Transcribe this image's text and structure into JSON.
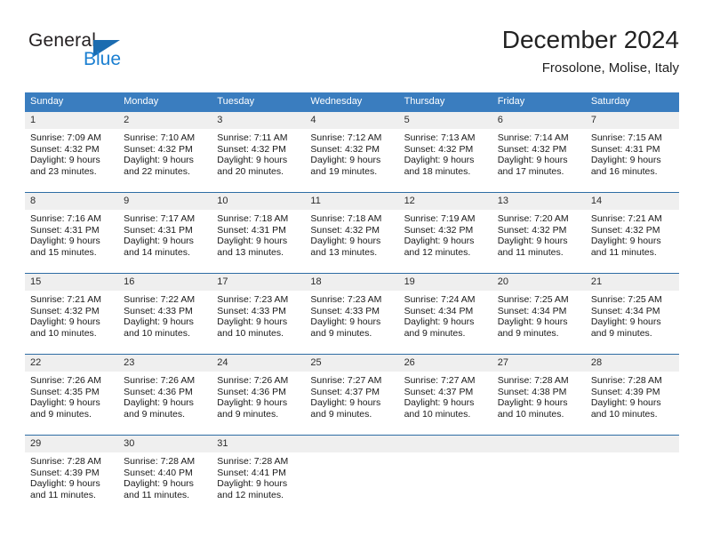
{
  "brand": {
    "name_top": "General",
    "name_bottom": "Blue",
    "triangle_icon": "brand-triangle-icon",
    "color_dark": "#231f20",
    "color_blue": "#1b7fd1"
  },
  "header": {
    "title": "December 2024",
    "subtitle": "Frosolone, Molise, Italy"
  },
  "theme": {
    "header_bg": "#3a7dbf",
    "daynum_bg": "#efefef",
    "row_rule": "#2e6da4"
  },
  "calendar": {
    "weekdays": [
      "Sunday",
      "Monday",
      "Tuesday",
      "Wednesday",
      "Thursday",
      "Friday",
      "Saturday"
    ],
    "weeks": [
      [
        {
          "day": "1",
          "sunrise": "Sunrise: 7:09 AM",
          "sunset": "Sunset: 4:32 PM",
          "daylight1": "Daylight: 9 hours",
          "daylight2": "and 23 minutes."
        },
        {
          "day": "2",
          "sunrise": "Sunrise: 7:10 AM",
          "sunset": "Sunset: 4:32 PM",
          "daylight1": "Daylight: 9 hours",
          "daylight2": "and 22 minutes."
        },
        {
          "day": "3",
          "sunrise": "Sunrise: 7:11 AM",
          "sunset": "Sunset: 4:32 PM",
          "daylight1": "Daylight: 9 hours",
          "daylight2": "and 20 minutes."
        },
        {
          "day": "4",
          "sunrise": "Sunrise: 7:12 AM",
          "sunset": "Sunset: 4:32 PM",
          "daylight1": "Daylight: 9 hours",
          "daylight2": "and 19 minutes."
        },
        {
          "day": "5",
          "sunrise": "Sunrise: 7:13 AM",
          "sunset": "Sunset: 4:32 PM",
          "daylight1": "Daylight: 9 hours",
          "daylight2": "and 18 minutes."
        },
        {
          "day": "6",
          "sunrise": "Sunrise: 7:14 AM",
          "sunset": "Sunset: 4:32 PM",
          "daylight1": "Daylight: 9 hours",
          "daylight2": "and 17 minutes."
        },
        {
          "day": "7",
          "sunrise": "Sunrise: 7:15 AM",
          "sunset": "Sunset: 4:31 PM",
          "daylight1": "Daylight: 9 hours",
          "daylight2": "and 16 minutes."
        }
      ],
      [
        {
          "day": "8",
          "sunrise": "Sunrise: 7:16 AM",
          "sunset": "Sunset: 4:31 PM",
          "daylight1": "Daylight: 9 hours",
          "daylight2": "and 15 minutes."
        },
        {
          "day": "9",
          "sunrise": "Sunrise: 7:17 AM",
          "sunset": "Sunset: 4:31 PM",
          "daylight1": "Daylight: 9 hours",
          "daylight2": "and 14 minutes."
        },
        {
          "day": "10",
          "sunrise": "Sunrise: 7:18 AM",
          "sunset": "Sunset: 4:31 PM",
          "daylight1": "Daylight: 9 hours",
          "daylight2": "and 13 minutes."
        },
        {
          "day": "11",
          "sunrise": "Sunrise: 7:18 AM",
          "sunset": "Sunset: 4:32 PM",
          "daylight1": "Daylight: 9 hours",
          "daylight2": "and 13 minutes."
        },
        {
          "day": "12",
          "sunrise": "Sunrise: 7:19 AM",
          "sunset": "Sunset: 4:32 PM",
          "daylight1": "Daylight: 9 hours",
          "daylight2": "and 12 minutes."
        },
        {
          "day": "13",
          "sunrise": "Sunrise: 7:20 AM",
          "sunset": "Sunset: 4:32 PM",
          "daylight1": "Daylight: 9 hours",
          "daylight2": "and 11 minutes."
        },
        {
          "day": "14",
          "sunrise": "Sunrise: 7:21 AM",
          "sunset": "Sunset: 4:32 PM",
          "daylight1": "Daylight: 9 hours",
          "daylight2": "and 11 minutes."
        }
      ],
      [
        {
          "day": "15",
          "sunrise": "Sunrise: 7:21 AM",
          "sunset": "Sunset: 4:32 PM",
          "daylight1": "Daylight: 9 hours",
          "daylight2": "and 10 minutes."
        },
        {
          "day": "16",
          "sunrise": "Sunrise: 7:22 AM",
          "sunset": "Sunset: 4:33 PM",
          "daylight1": "Daylight: 9 hours",
          "daylight2": "and 10 minutes."
        },
        {
          "day": "17",
          "sunrise": "Sunrise: 7:23 AM",
          "sunset": "Sunset: 4:33 PM",
          "daylight1": "Daylight: 9 hours",
          "daylight2": "and 10 minutes."
        },
        {
          "day": "18",
          "sunrise": "Sunrise: 7:23 AM",
          "sunset": "Sunset: 4:33 PM",
          "daylight1": "Daylight: 9 hours",
          "daylight2": "and 9 minutes."
        },
        {
          "day": "19",
          "sunrise": "Sunrise: 7:24 AM",
          "sunset": "Sunset: 4:34 PM",
          "daylight1": "Daylight: 9 hours",
          "daylight2": "and 9 minutes."
        },
        {
          "day": "20",
          "sunrise": "Sunrise: 7:25 AM",
          "sunset": "Sunset: 4:34 PM",
          "daylight1": "Daylight: 9 hours",
          "daylight2": "and 9 minutes."
        },
        {
          "day": "21",
          "sunrise": "Sunrise: 7:25 AM",
          "sunset": "Sunset: 4:34 PM",
          "daylight1": "Daylight: 9 hours",
          "daylight2": "and 9 minutes."
        }
      ],
      [
        {
          "day": "22",
          "sunrise": "Sunrise: 7:26 AM",
          "sunset": "Sunset: 4:35 PM",
          "daylight1": "Daylight: 9 hours",
          "daylight2": "and 9 minutes."
        },
        {
          "day": "23",
          "sunrise": "Sunrise: 7:26 AM",
          "sunset": "Sunset: 4:36 PM",
          "daylight1": "Daylight: 9 hours",
          "daylight2": "and 9 minutes."
        },
        {
          "day": "24",
          "sunrise": "Sunrise: 7:26 AM",
          "sunset": "Sunset: 4:36 PM",
          "daylight1": "Daylight: 9 hours",
          "daylight2": "and 9 minutes."
        },
        {
          "day": "25",
          "sunrise": "Sunrise: 7:27 AM",
          "sunset": "Sunset: 4:37 PM",
          "daylight1": "Daylight: 9 hours",
          "daylight2": "and 9 minutes."
        },
        {
          "day": "26",
          "sunrise": "Sunrise: 7:27 AM",
          "sunset": "Sunset: 4:37 PM",
          "daylight1": "Daylight: 9 hours",
          "daylight2": "and 10 minutes."
        },
        {
          "day": "27",
          "sunrise": "Sunrise: 7:28 AM",
          "sunset": "Sunset: 4:38 PM",
          "daylight1": "Daylight: 9 hours",
          "daylight2": "and 10 minutes."
        },
        {
          "day": "28",
          "sunrise": "Sunrise: 7:28 AM",
          "sunset": "Sunset: 4:39 PM",
          "daylight1": "Daylight: 9 hours",
          "daylight2": "and 10 minutes."
        }
      ],
      [
        {
          "day": "29",
          "sunrise": "Sunrise: 7:28 AM",
          "sunset": "Sunset: 4:39 PM",
          "daylight1": "Daylight: 9 hours",
          "daylight2": "and 11 minutes."
        },
        {
          "day": "30",
          "sunrise": "Sunrise: 7:28 AM",
          "sunset": "Sunset: 4:40 PM",
          "daylight1": "Daylight: 9 hours",
          "daylight2": "and 11 minutes."
        },
        {
          "day": "31",
          "sunrise": "Sunrise: 7:28 AM",
          "sunset": "Sunset: 4:41 PM",
          "daylight1": "Daylight: 9 hours",
          "daylight2": "and 12 minutes."
        },
        {
          "day": "",
          "sunrise": "",
          "sunset": "",
          "daylight1": "",
          "daylight2": ""
        },
        {
          "day": "",
          "sunrise": "",
          "sunset": "",
          "daylight1": "",
          "daylight2": ""
        },
        {
          "day": "",
          "sunrise": "",
          "sunset": "",
          "daylight1": "",
          "daylight2": ""
        },
        {
          "day": "",
          "sunrise": "",
          "sunset": "",
          "daylight1": "",
          "daylight2": ""
        }
      ]
    ]
  }
}
